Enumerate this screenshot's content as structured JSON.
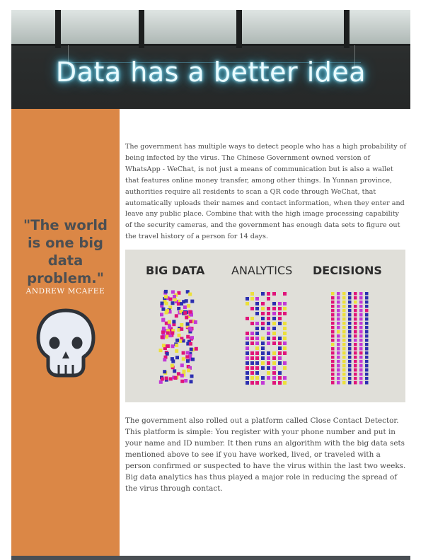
{
  "hero": {
    "title": "Data has a better idea"
  },
  "sidebar": {
    "quote": "\"The world is one big data problem.\"",
    "author": "ANDREW MCAFEE",
    "icon": "skull-icon",
    "background_color": "#db8746",
    "quote_color": "#4c4f52"
  },
  "article": {
    "paragraph1": "The government has multiple ways to detect people who has a high probability of being infected by the virus. The Chinese Government owned version of WhatsApp - WeChat, is not just a means of communication but is also a wallet that features online money transfer, among other things. In Yunnan province, authorities require all residents to scan a QR code through WeChat, that automatically uploads their names and contact information, when they enter and leave any public place. Combine that with the high image processing capability of the security cameras, and the government has enough data sets to figure out the travel history of a person for 14 days.",
    "paragraph2": "The government also rolled out a platform called Close Contact Detector. This platform is simple: You register with your phone number and put in your name and ID number. It then runs an algorithm with the big data sets mentioned above to see if you have worked, lived, or traveled with a person confirmed or suspected to have the virus within the last two weeks. Big data analytics has thus played a major role in reducing the spread of the virus through contact."
  },
  "figure": {
    "labels": [
      "BIG DATA",
      "ANALYTICS",
      "DECISIONS"
    ],
    "colors": [
      "#e0147a",
      "#ece03a",
      "#c238d6",
      "#2c2fb0"
    ]
  }
}
